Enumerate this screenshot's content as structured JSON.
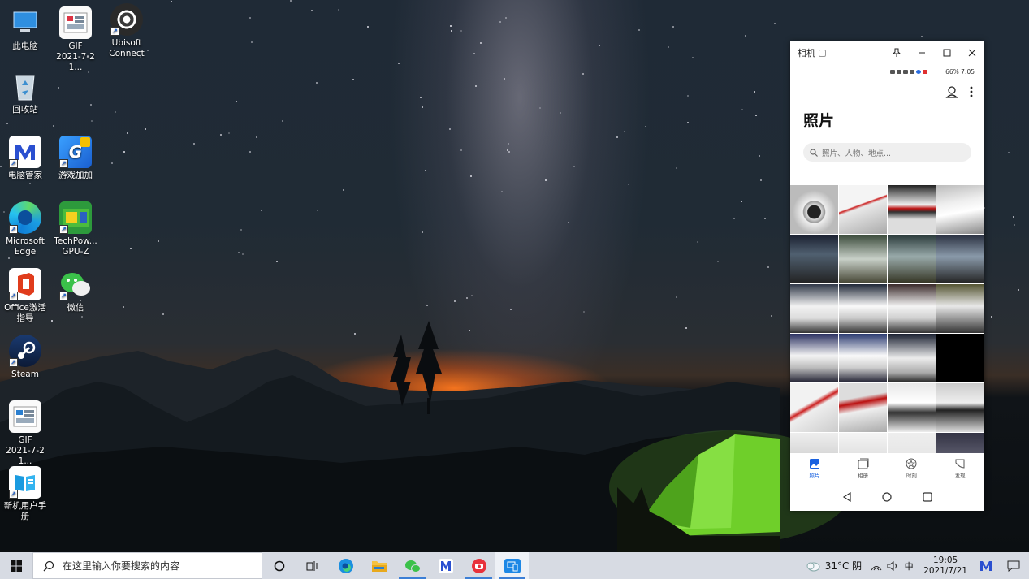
{
  "desktop": {
    "icons": [
      {
        "label": "此电脑",
        "icon": "computer-icon"
      },
      {
        "label": "GIF\n2021-7-21...",
        "icon": "gif-file-icon"
      },
      {
        "label": "Ubisoft\nConnect",
        "icon": "ubisoft-icon"
      },
      {
        "label": "回收站",
        "icon": "recycle-bin-icon"
      },
      {
        "label": "电脑管家",
        "icon": "pc-manager-icon"
      },
      {
        "label": "游戏加加",
        "icon": "game-plus-icon"
      },
      {
        "label": "Microsoft\nEdge",
        "icon": "edge-icon"
      },
      {
        "label": "TechPow...\nGPU-Z",
        "icon": "gpuz-icon"
      },
      {
        "label": "Office激活\n指导",
        "icon": "office-icon"
      },
      {
        "label": "微信",
        "icon": "wechat-icon"
      },
      {
        "label": "Steam",
        "icon": "steam-icon"
      },
      {
        "label": "GIF\n2021-7-21...",
        "icon": "gif-file-icon"
      },
      {
        "label": "新机用户手册",
        "icon": "user-manual-icon"
      }
    ]
  },
  "phone_window": {
    "title": "相机",
    "status": {
      "right": "66%  7:05"
    },
    "page_title": "照片",
    "search_placeholder": "照片、人物、地点...",
    "nav": [
      {
        "label": "照片",
        "icon": "photos-icon",
        "active": true
      },
      {
        "label": "相册",
        "icon": "albums-icon",
        "active": false
      },
      {
        "label": "时刻",
        "icon": "moments-icon",
        "active": false
      },
      {
        "label": "发现",
        "icon": "discover-icon",
        "active": false
      }
    ]
  },
  "taskbar": {
    "search_placeholder": "在这里输入你要搜索的内容",
    "weather": "31°C  阴",
    "ime": "中",
    "time": "19:05",
    "date": "2021/7/21"
  },
  "colors": {
    "accent": "#1a62e0",
    "taskbar": "#d7dbe3",
    "tent": "#6fcf2a"
  }
}
